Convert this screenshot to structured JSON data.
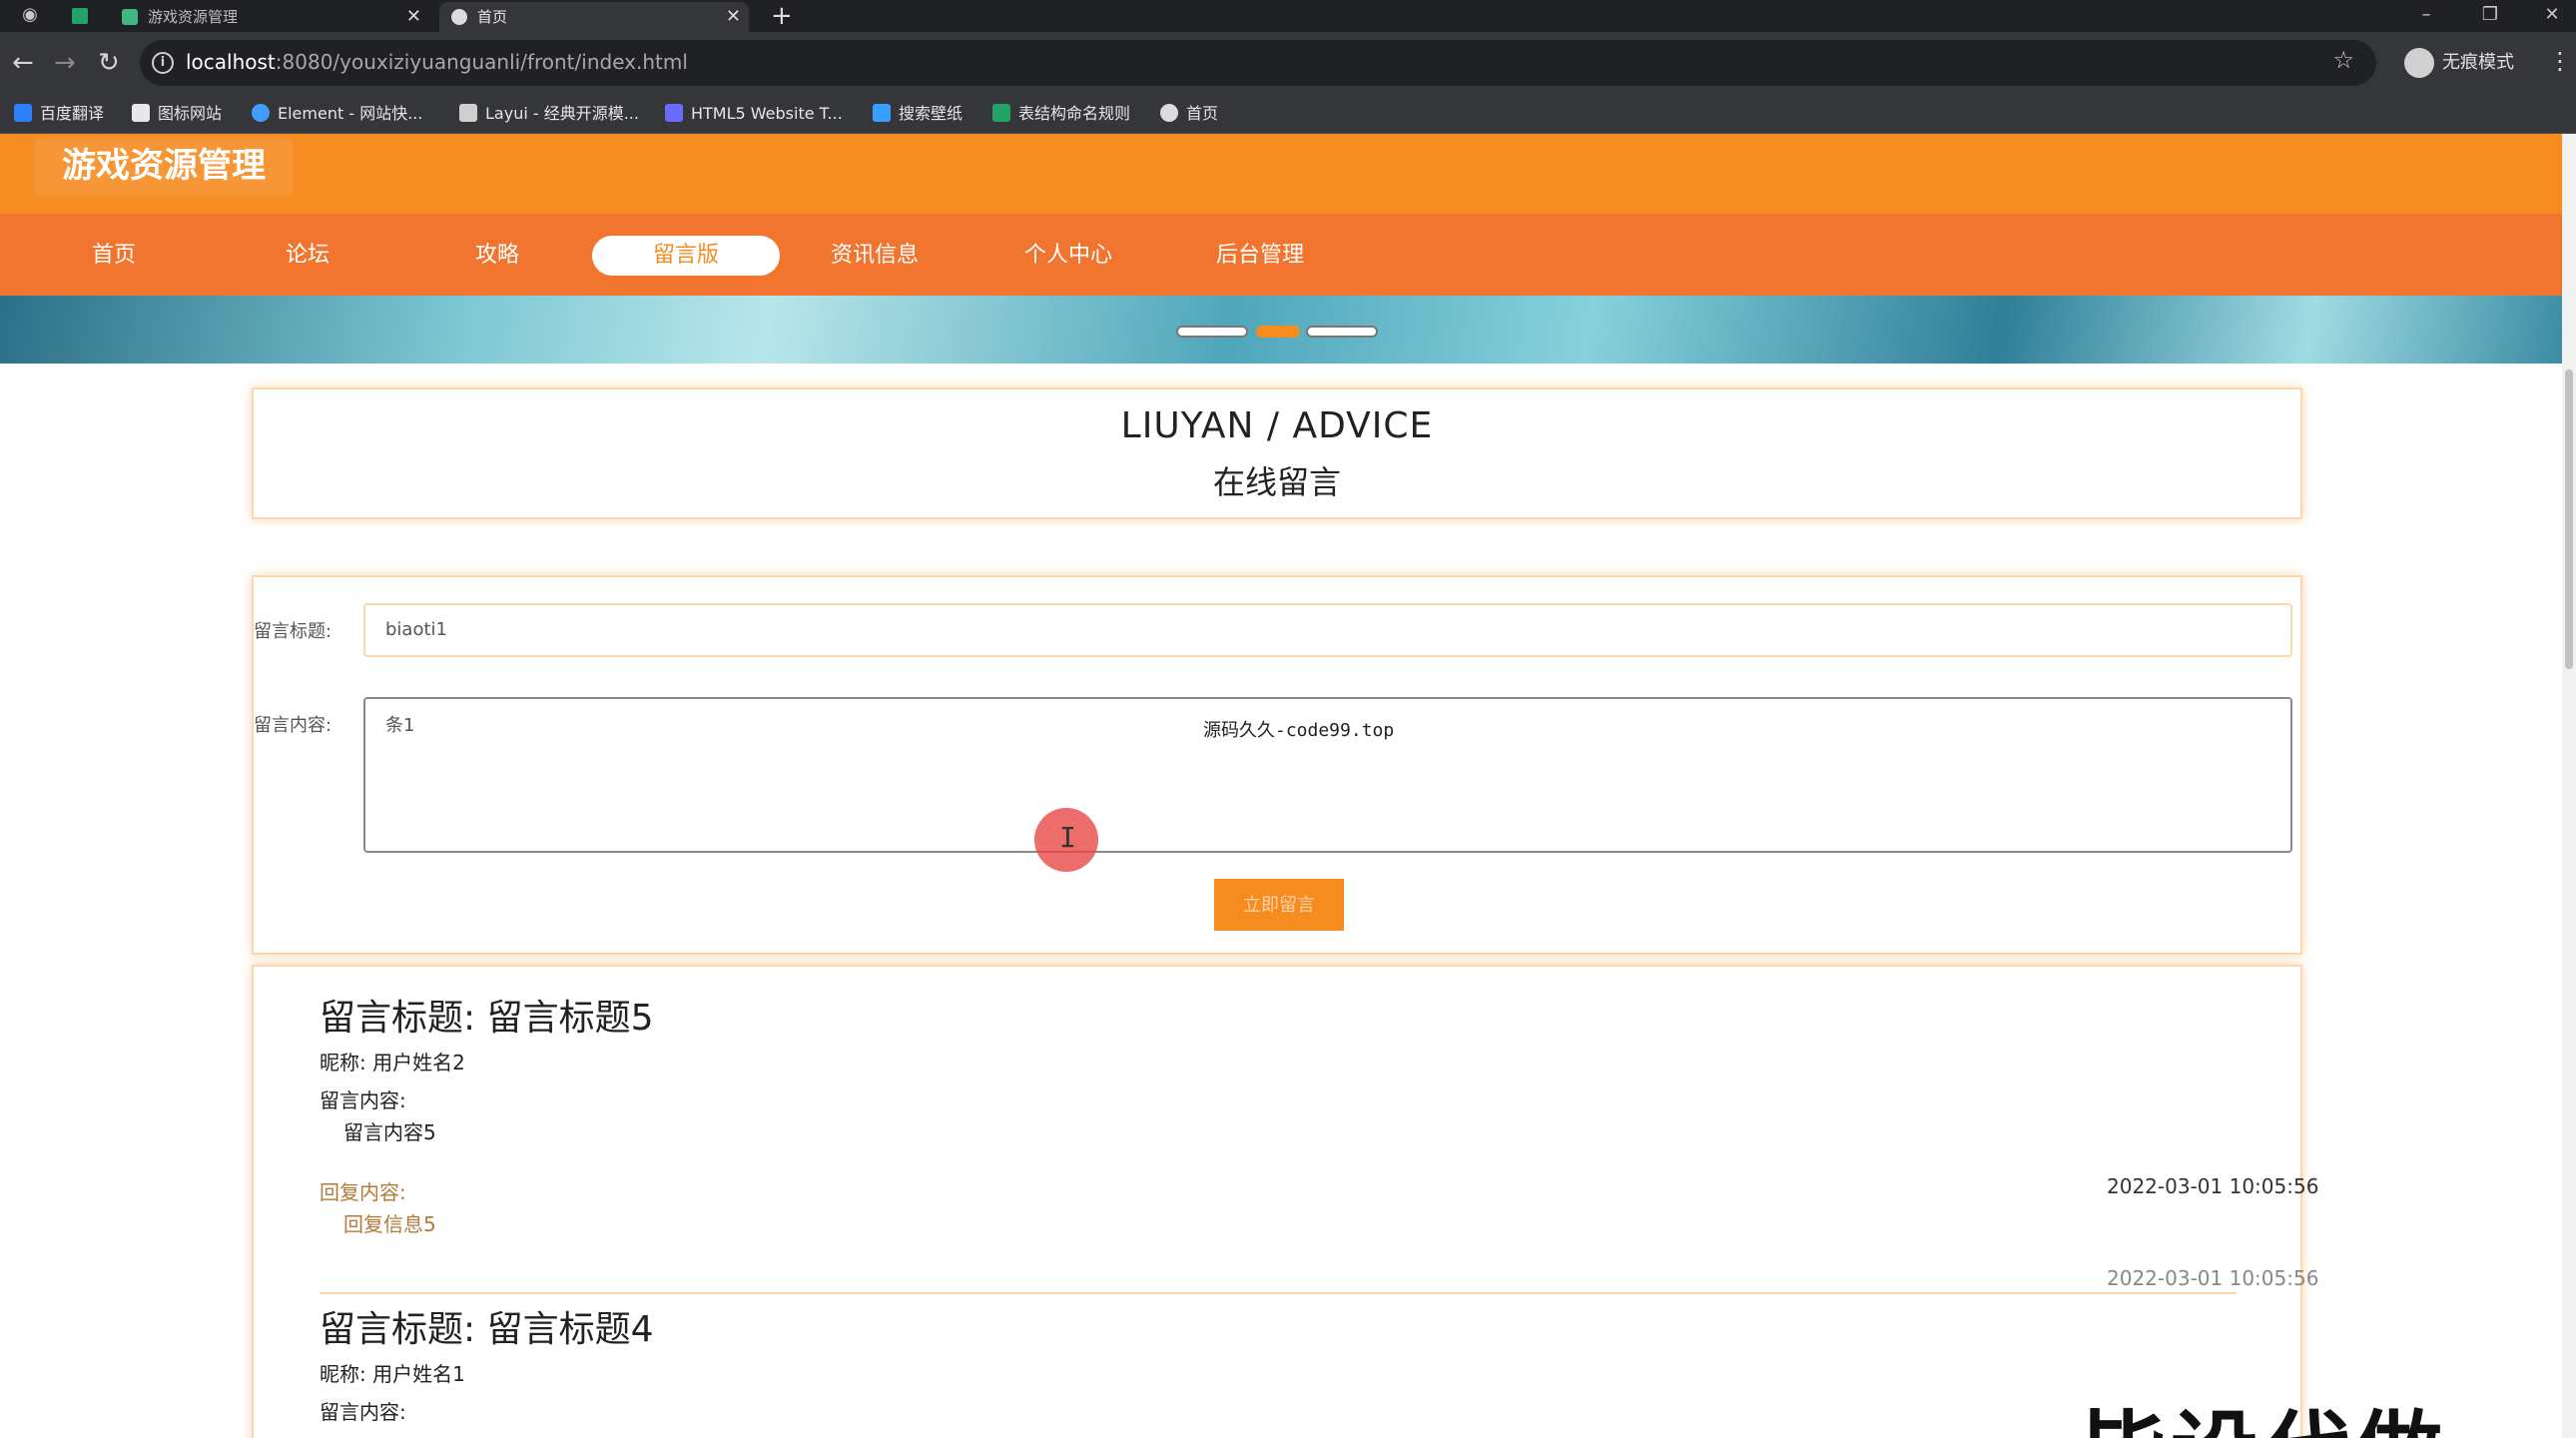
{
  "browser": {
    "tabs": [
      {
        "title": "游戏资源管理",
        "active": false
      },
      {
        "title": "首页",
        "active": true
      }
    ],
    "url_host": "localhost",
    "url_path": ":8080/youxiziyuanguanli/front/index.html",
    "incognito_label": "无痕模式",
    "bookmarks": [
      "百度翻译",
      "图标网站",
      "Element - 网站快...",
      "Layui - 经典开源模...",
      "HTML5 Website T...",
      "搜索壁纸",
      "表结构命名规则",
      "首页"
    ]
  },
  "site": {
    "title": "游戏资源管理",
    "nav": [
      "首页",
      "论坛",
      "攻略",
      "留言版",
      "资讯信息",
      "个人中心",
      "后台管理"
    ],
    "active_nav": "留言版"
  },
  "section": {
    "title_en": "LIUYAN / ADVICE",
    "title_cn": "在线留言"
  },
  "form": {
    "title_label": "留言标题:",
    "title_value": "biaoti1",
    "content_label": "留言内容:",
    "content_value": "条1",
    "submit_label": "立即留言"
  },
  "watermarks": {
    "center_text": "源码久久-code99.top",
    "overlay_text": "毕设代做"
  },
  "messages": [
    {
      "title": "留言标题: 留言标题5",
      "nickname": "昵称: 用户姓名2",
      "content_label": "留言内容:",
      "content": "留言内容5",
      "reply_label": "回复内容:",
      "reply": "回复信息5",
      "time": "2022-03-01 10:05:56",
      "reply_time": "2022-03-01 10:05:56"
    },
    {
      "title": "留言标题: 留言标题4",
      "nickname": "昵称: 用户姓名1",
      "content_label": "留言内容:"
    }
  ],
  "colors": {
    "header_orange": "#f68b20",
    "nav_orange": "#f2752f",
    "card_border": "#fbd8ad",
    "reply_text": "#b37a3a"
  },
  "icons": [
    "chrome-icon",
    "sheet-icon",
    "vue-icon",
    "back-icon",
    "forward-icon",
    "reload-icon",
    "info-icon",
    "star-icon",
    "incognito-icon",
    "menu-icon"
  ]
}
